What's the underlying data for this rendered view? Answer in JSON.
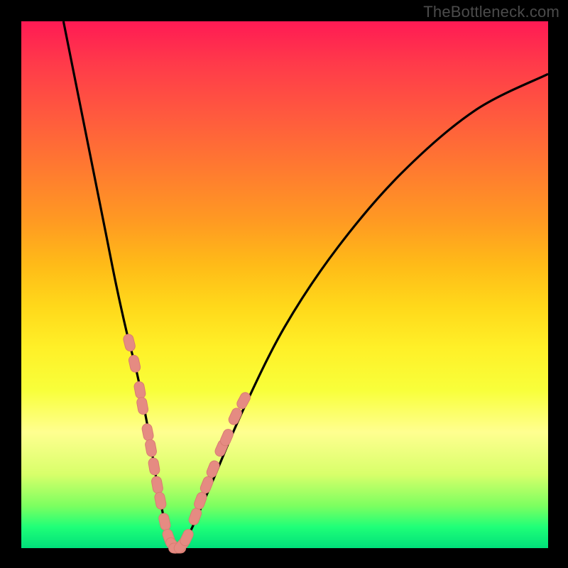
{
  "watermark": "TheBottleneck.com",
  "colors": {
    "curve_stroke": "#000000",
    "marker_fill": "#e58b82",
    "marker_stroke": "#d97c72"
  },
  "chart_data": {
    "type": "line",
    "title": "",
    "xlabel": "",
    "ylabel": "",
    "xlim": [
      0,
      100
    ],
    "ylim": [
      0,
      100
    ],
    "series": [
      {
        "name": "bottleneck-curve",
        "x": [
          8,
          10,
          12,
          14,
          16,
          18,
          20,
          22,
          24,
          25,
          26,
          27,
          28,
          29,
          30,
          32,
          36,
          42,
          50,
          60,
          72,
          86,
          100
        ],
        "y": [
          100,
          90,
          80,
          70,
          60,
          50,
          41,
          33,
          23,
          17,
          11,
          6,
          2,
          0,
          0,
          3,
          12,
          26,
          42,
          57,
          71,
          83,
          90
        ]
      }
    ],
    "markers": {
      "name": "highlighted-points",
      "points": [
        {
          "x": 20.5,
          "y": 39
        },
        {
          "x": 21.5,
          "y": 35
        },
        {
          "x": 22.5,
          "y": 30
        },
        {
          "x": 23.0,
          "y": 27
        },
        {
          "x": 24.0,
          "y": 22
        },
        {
          "x": 24.6,
          "y": 19
        },
        {
          "x": 25.2,
          "y": 15.5
        },
        {
          "x": 25.8,
          "y": 12
        },
        {
          "x": 26.4,
          "y": 9
        },
        {
          "x": 27.2,
          "y": 5
        },
        {
          "x": 28.0,
          "y": 2
        },
        {
          "x": 28.8,
          "y": 0.5
        },
        {
          "x": 29.6,
          "y": 0
        },
        {
          "x": 30.4,
          "y": 0.5
        },
        {
          "x": 31.4,
          "y": 2
        },
        {
          "x": 33.0,
          "y": 6
        },
        {
          "x": 34.0,
          "y": 9
        },
        {
          "x": 35.2,
          "y": 12
        },
        {
          "x": 36.4,
          "y": 15
        },
        {
          "x": 38.0,
          "y": 19
        },
        {
          "x": 39.0,
          "y": 21
        },
        {
          "x": 40.6,
          "y": 25
        },
        {
          "x": 42.2,
          "y": 28
        }
      ]
    }
  }
}
